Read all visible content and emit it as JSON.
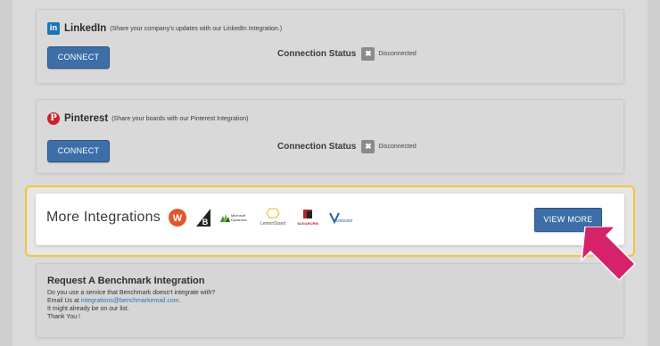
{
  "linkedin": {
    "title": "LinkedIn",
    "icon": "linkedin-logo-icon",
    "icon_text": "in",
    "description": "(Share your company's updates with our LinkedIn Integration.)",
    "connect_label": "CONNECT",
    "status_label": "Connection Status",
    "status_icon": "x-icon",
    "status_value": "Disconnected"
  },
  "pinterest": {
    "title": "Pinterest",
    "icon": "pinterest-logo-icon",
    "icon_text": "P",
    "description": "(Share your boards with our Pinterest Integration)",
    "connect_label": "CONNECT",
    "status_label": "Connection Status",
    "status_icon": "x-icon",
    "status_value": "Disconnected"
  },
  "more_integrations": {
    "title": "More Integrations",
    "logos": [
      "wufoo-logo",
      "bigcommerce-logo",
      "microsoft-dynamics-logo",
      "lemonstand-logo",
      "sugarcrm-logo",
      "volusion-logo"
    ],
    "microsoft_text": "Microsoft",
    "dynamics_text": "Dynamics",
    "lemonstand_text": "LemonStand",
    "sugar_text": "SUGARCRM",
    "volusion_text": "volusion",
    "view_more_label": "VIEW MORE",
    "highlight_color": "#f3c53a"
  },
  "request": {
    "title": "Request A Benchmark Integration",
    "line1": "Do you use a service that Benchmark doesn't integrate with?",
    "line2_prefix": "Email Us at ",
    "line2_email": "integrations@benchmarkemail.com",
    "line2_suffix": ".",
    "line3": "It might already be on our list.",
    "line4": "Thank You !"
  },
  "colors": {
    "button_blue": "#3d6ea8",
    "arrow_pink": "#d6216b",
    "linkedin_blue": "#1c75b3",
    "pinterest_red": "#c8232c"
  }
}
